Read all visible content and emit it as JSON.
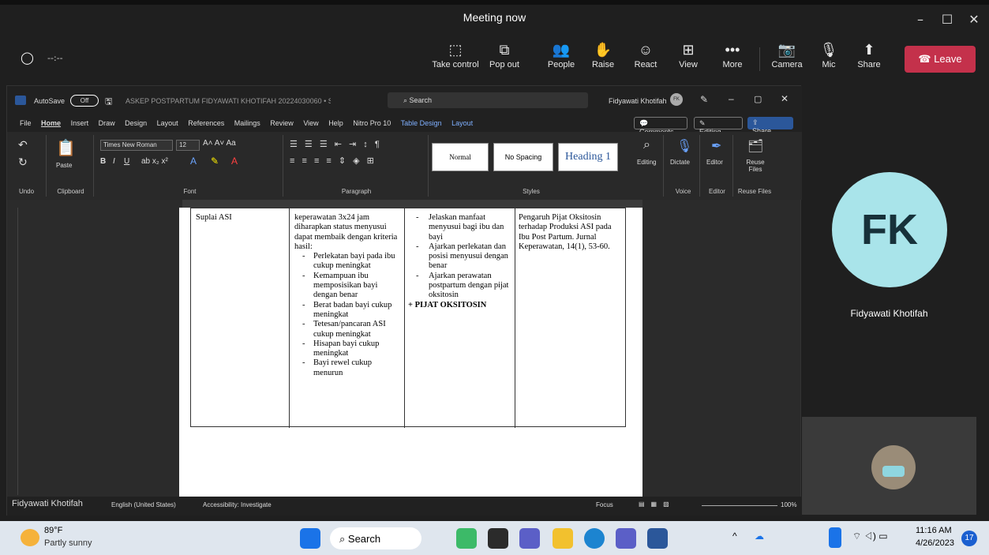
{
  "window": {
    "title": "Meeting now",
    "min": "–",
    "max": "☐",
    "close": "✕"
  },
  "meeting": {
    "timer": "--:--",
    "shield": "◯",
    "take_control": "Take control",
    "pop_out": "Pop out",
    "people": "People",
    "raise": "Raise",
    "react": "React",
    "view": "View",
    "more": "More",
    "camera": "Camera",
    "mic": "Mic",
    "share": "Share",
    "leave": "Leave"
  },
  "word": {
    "autosave": "AutoSave",
    "autosave_state": "Off",
    "doc_title": "ASKEP POSTPARTUM FIDYAWATI KHOTIFAH 20224030060 • Saved ⌄",
    "search": "Search",
    "user": "Fidyawati Khotifah",
    "user_initials": "FK",
    "menu": [
      "File",
      "Home",
      "Insert",
      "Draw",
      "Design",
      "Layout",
      "References",
      "Mailings",
      "Review",
      "View",
      "Help",
      "Nitro Pro 10",
      "Table Design",
      "Layout"
    ],
    "comments": "Comments",
    "editing": "Editing",
    "share": "Share",
    "font_name": "Times New Roman",
    "font_size": "12",
    "paste": "Paste",
    "groups": {
      "undo": "Undo",
      "clipboard": "Clipboard",
      "font": "Font",
      "paragraph": "Paragraph",
      "styles": "Styles",
      "voice": "Voice",
      "editor": "Editor",
      "reuse": "Reuse Files"
    },
    "styles": {
      "normal": "Normal",
      "nospacing": "No Spacing",
      "heading1": "Heading 1"
    },
    "tools": {
      "editing": "Editing",
      "dictate": "Dictate",
      "editor": "Editor",
      "reuse": "Reuse Files"
    },
    "col1": [
      "Suplai ASI"
    ],
    "col2_intro": "keperawatan 3x24 jam diharapkan status menyusui dapat membaik dengan kriteria hasil:",
    "col2_items": [
      "Perlekatan bayi pada ibu cukup meningkat",
      "Kemampuan ibu memposisikan bayi dengan benar",
      "Berat badan bayi cukup meningkat",
      "Tetesan/pancaran ASI cukup meningkat",
      "Hisapan bayi cukup meningkat",
      "Bayi rewel cukup menurun"
    ],
    "col3_items": [
      "Jelaskan manfaat menyusui bagi ibu dan bayi",
      "Ajarkan perlekatan dan posisi menyusui dengan benar",
      "Ajarkan perawatan postpartum dengan pijat oksitosin"
    ],
    "col3_bold": "+ PIJAT OKSITOSIN",
    "col4": "Pengaruh Pijat Oksitosin terhadap Produksi ASI pada Ibu Post Partum. Jurnal Keperawatan, 14(1), 53-60.",
    "status": {
      "name": "Fidyawati Khotifah",
      "language": "English (United States)",
      "accessibility": "Accessibility: Investigate",
      "focus": "Focus",
      "zoom": "100%"
    }
  },
  "participant": {
    "initials": "FK",
    "name": "Fidyawati Khotifah"
  },
  "taskbar": {
    "temp": "89°F",
    "weather": "Partly sunny",
    "search": "Search",
    "time": "11:16 AM",
    "date": "4/26/2023",
    "badge": "17"
  }
}
